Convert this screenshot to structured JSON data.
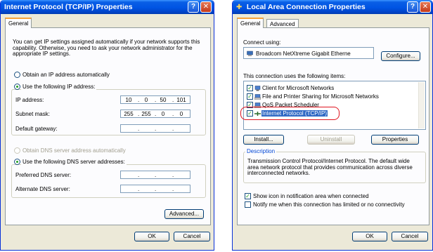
{
  "tcpip": {
    "title": "Internet Protocol (TCP/IP) Properties",
    "help_button": "?",
    "close_button": "✕",
    "tab_general": "General",
    "intro_text": "You can get IP settings assigned automatically if your network supports this capability. Otherwise, you need to ask your network administrator for the appropriate IP settings.",
    "obtain_ip_auto": "Obtain an IP address automatically",
    "use_following_ip": "Use the following IP address:",
    "ip_address_label": "IP address:",
    "ip_address": [
      "10",
      "0",
      "50",
      "101"
    ],
    "subnet_mask_label": "Subnet mask:",
    "subnet_mask": [
      "255",
      "255",
      "0",
      "0"
    ],
    "default_gateway_label": "Default gateway:",
    "default_gateway": [
      "",
      "",
      "",
      ""
    ],
    "obtain_dns_auto": "Obtain DNS server address automatically",
    "use_following_dns": "Use the following DNS server addresses:",
    "preferred_dns_label": "Preferred DNS server:",
    "alternate_dns_label": "Alternate DNS server:",
    "advanced_button": "Advanced...",
    "ok_button": "OK",
    "cancel_button": "Cancel"
  },
  "lan": {
    "title": "Local Area Connection Properties",
    "help_button": "?",
    "close_button": "✕",
    "tab_general": "General",
    "tab_advanced": "Advanced",
    "connect_using_label": "Connect using:",
    "adapter_name": "Broadcom NetXtreme Gigabit Etherne",
    "configure_button": "Configure...",
    "items_label": "This connection uses the following items:",
    "items": [
      {
        "label": "Client for Microsoft Networks",
        "checked": true,
        "icon": "network-client-icon"
      },
      {
        "label": "File and Printer Sharing for Microsoft Networks",
        "checked": true,
        "icon": "network-service-icon"
      },
      {
        "label": "QoS Packet Scheduler",
        "checked": true,
        "icon": "network-service-icon"
      },
      {
        "label": "Internet Protocol (TCP/IP)",
        "checked": true,
        "icon": "network-protocol-icon",
        "selected": true
      }
    ],
    "install_button": "Install...",
    "uninstall_button": "Uninstall",
    "properties_button": "Properties",
    "description_legend": "Description",
    "description_text": "Transmission Control Protocol/Internet Protocol. The default wide area network protocol that provides communication across diverse interconnected networks.",
    "show_icon_label": "Show icon in notification area when connected",
    "notify_label": "Notify me when this connection has limited or no connectivity",
    "ok_button": "OK",
    "cancel_button": "Cancel"
  },
  "colors": {
    "titlebar": "#0054e3",
    "dialog_bg": "#ece9d8",
    "selection": "#316ac5",
    "annotation": "#e0141e"
  }
}
